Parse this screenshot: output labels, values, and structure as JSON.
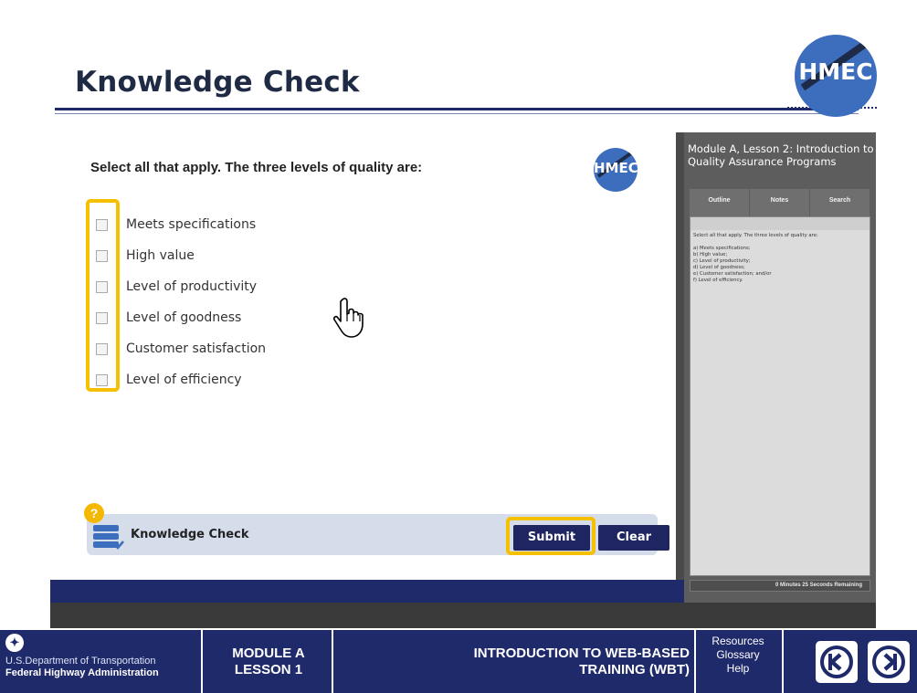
{
  "header": {
    "title": "Knowledge Check",
    "logo_text": "HMEC"
  },
  "slide": {
    "question": "Select all that apply. The three levels of quality are:",
    "logo_text": "HMEC",
    "options": [
      {
        "letter": ")",
        "label": "Meets specifications"
      },
      {
        "letter": ")",
        "label": "High value"
      },
      {
        "letter": ")",
        "label": "Level of productivity"
      },
      {
        "letter": ")",
        "label": "Level of goodness"
      },
      {
        "letter": ")",
        "label": "Customer satisfaction"
      },
      {
        "letter": ")",
        "label": "Level of efficiency"
      }
    ],
    "kc_label": "Knowledge Check",
    "badge": "?",
    "submit_label": "Submit",
    "clear_label": "Clear"
  },
  "sidebar": {
    "title": "Module A, Lesson 2: Introduction to Quality Assurance Programs",
    "tabs": [
      "Outline",
      "Notes",
      "Search"
    ],
    "notes_lines": [
      "Select all that apply. The three levels of quality are:",
      "",
      "a) Meets specifications;",
      "b) High value;",
      "c) Level of productivity;",
      "d) Level of goodness;",
      "e) Customer satisfaction; and/or",
      "f) Level of efficiency."
    ],
    "timer": "0 Minutes 25 Seconds Remaining"
  },
  "footer": {
    "dept_line1": "U.S.Department of Transportation",
    "dept_line2": "Federal Highway Administration",
    "module_line1": "MODULE A",
    "module_line2": "LESSON 1",
    "course_line1": "INTRODUCTION TO WEB-BASED",
    "course_line2": "TRAINING (WBT)",
    "links": [
      "Resources",
      "Glossary",
      "Help"
    ]
  },
  "colors": {
    "navy": "#1f2a6a",
    "highlight": "#f5c000",
    "logo_blue": "#3d6ebd"
  }
}
